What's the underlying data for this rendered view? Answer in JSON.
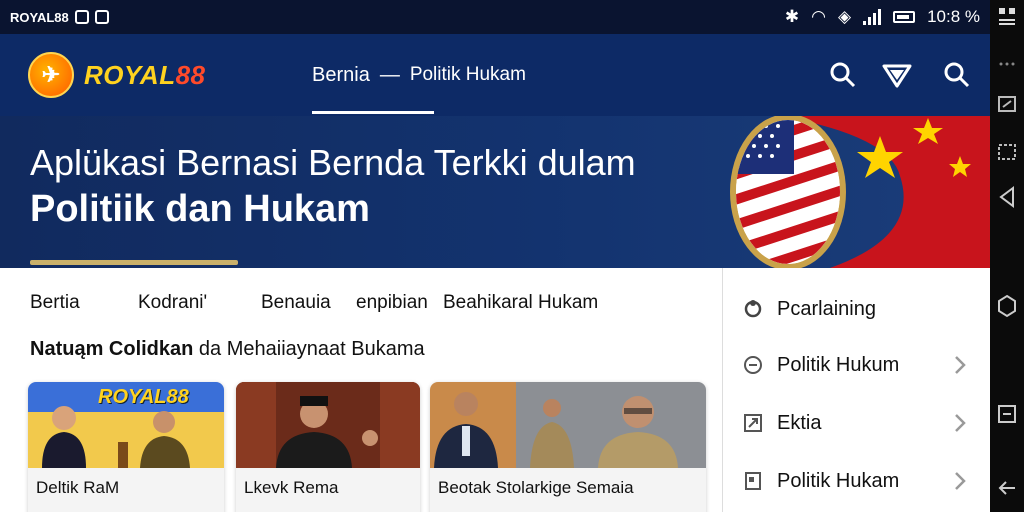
{
  "status_bar": {
    "carrier": "ROYAL88",
    "time": "10:8 %"
  },
  "header": {
    "logo_text": "ROYAL",
    "logo_number": "88",
    "nav_main": "Bernia",
    "nav_separator": "—",
    "nav_sub": "Politik Hukam",
    "icons": [
      "search-icon",
      "send-icon",
      "search-icon"
    ]
  },
  "hero": {
    "title_line1": "Aplükasi Bernasi Bernda Terkki dulam",
    "title_line2": "Politiik dan Hukam"
  },
  "categories": [
    "Bertia",
    "Kodrani'",
    "Benauia",
    "enpibian",
    "Beahikaral Hukam"
  ],
  "section_heading_bold": "Natuąm Colidkan",
  "section_heading_rest": " da Mehaiiaynaat Bukama",
  "cards": [
    {
      "caption": "Deltik RaM",
      "banner": "ROYAL88"
    },
    {
      "caption": "Lkevk Rema"
    },
    {
      "caption": "Beotak Stolarkige Semaia"
    }
  ],
  "side_menu": [
    {
      "label": "Pcarlaining",
      "icon": "share-icon",
      "chevron": false
    },
    {
      "label": "Politik Hukum",
      "icon": "minus-circle-icon",
      "chevron": true
    },
    {
      "label": "Ektia",
      "icon": "expand-icon",
      "chevron": true
    },
    {
      "label": "Politik Hukam",
      "icon": "doc-icon",
      "chevron": true
    }
  ],
  "colors": {
    "header_bg": "#0d2a66",
    "status_bg": "#0a1430",
    "accent_gold": "#ffd21f",
    "accent_red": "#ff4a2a"
  }
}
